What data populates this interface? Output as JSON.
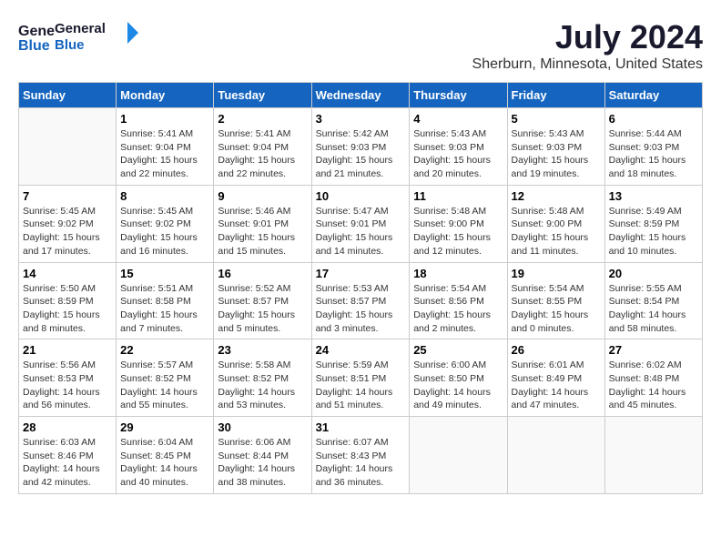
{
  "header": {
    "logo_general": "General",
    "logo_blue": "Blue",
    "title": "July 2024",
    "subtitle": "Sherburn, Minnesota, United States"
  },
  "weekdays": [
    "Sunday",
    "Monday",
    "Tuesday",
    "Wednesday",
    "Thursday",
    "Friday",
    "Saturday"
  ],
  "weeks": [
    [
      {
        "day": "",
        "info": ""
      },
      {
        "day": "1",
        "info": "Sunrise: 5:41 AM\nSunset: 9:04 PM\nDaylight: 15 hours\nand 22 minutes."
      },
      {
        "day": "2",
        "info": "Sunrise: 5:41 AM\nSunset: 9:04 PM\nDaylight: 15 hours\nand 22 minutes."
      },
      {
        "day": "3",
        "info": "Sunrise: 5:42 AM\nSunset: 9:03 PM\nDaylight: 15 hours\nand 21 minutes."
      },
      {
        "day": "4",
        "info": "Sunrise: 5:43 AM\nSunset: 9:03 PM\nDaylight: 15 hours\nand 20 minutes."
      },
      {
        "day": "5",
        "info": "Sunrise: 5:43 AM\nSunset: 9:03 PM\nDaylight: 15 hours\nand 19 minutes."
      },
      {
        "day": "6",
        "info": "Sunrise: 5:44 AM\nSunset: 9:03 PM\nDaylight: 15 hours\nand 18 minutes."
      }
    ],
    [
      {
        "day": "7",
        "info": "Sunrise: 5:45 AM\nSunset: 9:02 PM\nDaylight: 15 hours\nand 17 minutes."
      },
      {
        "day": "8",
        "info": "Sunrise: 5:45 AM\nSunset: 9:02 PM\nDaylight: 15 hours\nand 16 minutes."
      },
      {
        "day": "9",
        "info": "Sunrise: 5:46 AM\nSunset: 9:01 PM\nDaylight: 15 hours\nand 15 minutes."
      },
      {
        "day": "10",
        "info": "Sunrise: 5:47 AM\nSunset: 9:01 PM\nDaylight: 15 hours\nand 14 minutes."
      },
      {
        "day": "11",
        "info": "Sunrise: 5:48 AM\nSunset: 9:00 PM\nDaylight: 15 hours\nand 12 minutes."
      },
      {
        "day": "12",
        "info": "Sunrise: 5:48 AM\nSunset: 9:00 PM\nDaylight: 15 hours\nand 11 minutes."
      },
      {
        "day": "13",
        "info": "Sunrise: 5:49 AM\nSunset: 8:59 PM\nDaylight: 15 hours\nand 10 minutes."
      }
    ],
    [
      {
        "day": "14",
        "info": "Sunrise: 5:50 AM\nSunset: 8:59 PM\nDaylight: 15 hours\nand 8 minutes."
      },
      {
        "day": "15",
        "info": "Sunrise: 5:51 AM\nSunset: 8:58 PM\nDaylight: 15 hours\nand 7 minutes."
      },
      {
        "day": "16",
        "info": "Sunrise: 5:52 AM\nSunset: 8:57 PM\nDaylight: 15 hours\nand 5 minutes."
      },
      {
        "day": "17",
        "info": "Sunrise: 5:53 AM\nSunset: 8:57 PM\nDaylight: 15 hours\nand 3 minutes."
      },
      {
        "day": "18",
        "info": "Sunrise: 5:54 AM\nSunset: 8:56 PM\nDaylight: 15 hours\nand 2 minutes."
      },
      {
        "day": "19",
        "info": "Sunrise: 5:54 AM\nSunset: 8:55 PM\nDaylight: 15 hours\nand 0 minutes."
      },
      {
        "day": "20",
        "info": "Sunrise: 5:55 AM\nSunset: 8:54 PM\nDaylight: 14 hours\nand 58 minutes."
      }
    ],
    [
      {
        "day": "21",
        "info": "Sunrise: 5:56 AM\nSunset: 8:53 PM\nDaylight: 14 hours\nand 56 minutes."
      },
      {
        "day": "22",
        "info": "Sunrise: 5:57 AM\nSunset: 8:52 PM\nDaylight: 14 hours\nand 55 minutes."
      },
      {
        "day": "23",
        "info": "Sunrise: 5:58 AM\nSunset: 8:52 PM\nDaylight: 14 hours\nand 53 minutes."
      },
      {
        "day": "24",
        "info": "Sunrise: 5:59 AM\nSunset: 8:51 PM\nDaylight: 14 hours\nand 51 minutes."
      },
      {
        "day": "25",
        "info": "Sunrise: 6:00 AM\nSunset: 8:50 PM\nDaylight: 14 hours\nand 49 minutes."
      },
      {
        "day": "26",
        "info": "Sunrise: 6:01 AM\nSunset: 8:49 PM\nDaylight: 14 hours\nand 47 minutes."
      },
      {
        "day": "27",
        "info": "Sunrise: 6:02 AM\nSunset: 8:48 PM\nDaylight: 14 hours\nand 45 minutes."
      }
    ],
    [
      {
        "day": "28",
        "info": "Sunrise: 6:03 AM\nSunset: 8:46 PM\nDaylight: 14 hours\nand 42 minutes."
      },
      {
        "day": "29",
        "info": "Sunrise: 6:04 AM\nSunset: 8:45 PM\nDaylight: 14 hours\nand 40 minutes."
      },
      {
        "day": "30",
        "info": "Sunrise: 6:06 AM\nSunset: 8:44 PM\nDaylight: 14 hours\nand 38 minutes."
      },
      {
        "day": "31",
        "info": "Sunrise: 6:07 AM\nSunset: 8:43 PM\nDaylight: 14 hours\nand 36 minutes."
      },
      {
        "day": "",
        "info": ""
      },
      {
        "day": "",
        "info": ""
      },
      {
        "day": "",
        "info": ""
      }
    ]
  ]
}
